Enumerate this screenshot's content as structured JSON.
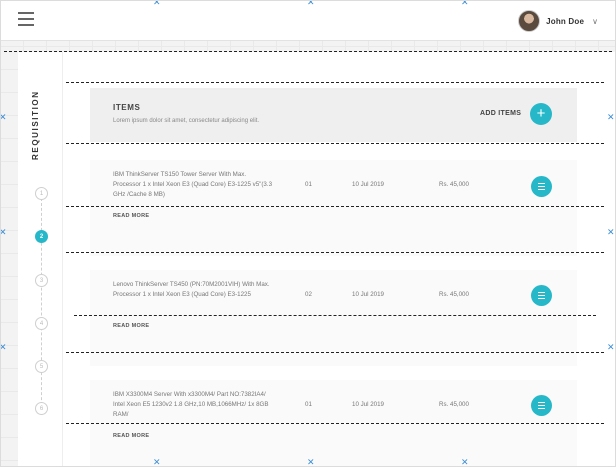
{
  "header": {
    "user_name": "John Doe",
    "icons": {
      "menu": "hamburger-menu-icon",
      "avatar": "user-avatar",
      "dropdown": "chevron-down-icon"
    }
  },
  "stepper": {
    "label": "REQUISITION",
    "steps": [
      "1",
      "2",
      "3",
      "4",
      "5",
      "6"
    ],
    "active_step": "2"
  },
  "items_section": {
    "title": "ITEMS",
    "subtitle": "Lorem ipsum dolor sit amet, consectetur adipiscing elit.",
    "add_label": "ADD ITEMS",
    "add_icon": "+"
  },
  "items": [
    {
      "description": "IBM ThinkServer TS150 Tower Server With Max. Processor 1 x Intel Xeon E3 (Quad Core) E3-1225 v5\"(3.3 GHz /Cache 8 MB)",
      "quantity": "01",
      "date": "10 Jul 2019",
      "price": "Rs. 45,000",
      "read_more": "READ MORE"
    },
    {
      "description": "Lenovo ThinkServer TS450 (PN:70M2001VIH) With Max. Processor 1 x Intel Xeon E3 (Quad Core) E3-1225",
      "quantity": "02",
      "date": "10 Jul 2019",
      "price": "Rs. 45,000",
      "read_more": "READ MORE"
    },
    {
      "description": "IBM X3300M4 Server With x3300M4/ Part NO:7382IA4/ Intel Xeon E5 1230v2 1.8 GHz,10 MB,1066MHz/ 1x 8GB RAM/",
      "quantity": "01",
      "date": "10 Jul 2019",
      "price": "Rs. 45,000",
      "read_more": "READ MORE"
    }
  ],
  "colors": {
    "accent": "#26b8c9",
    "background": "#f3f3f3"
  }
}
